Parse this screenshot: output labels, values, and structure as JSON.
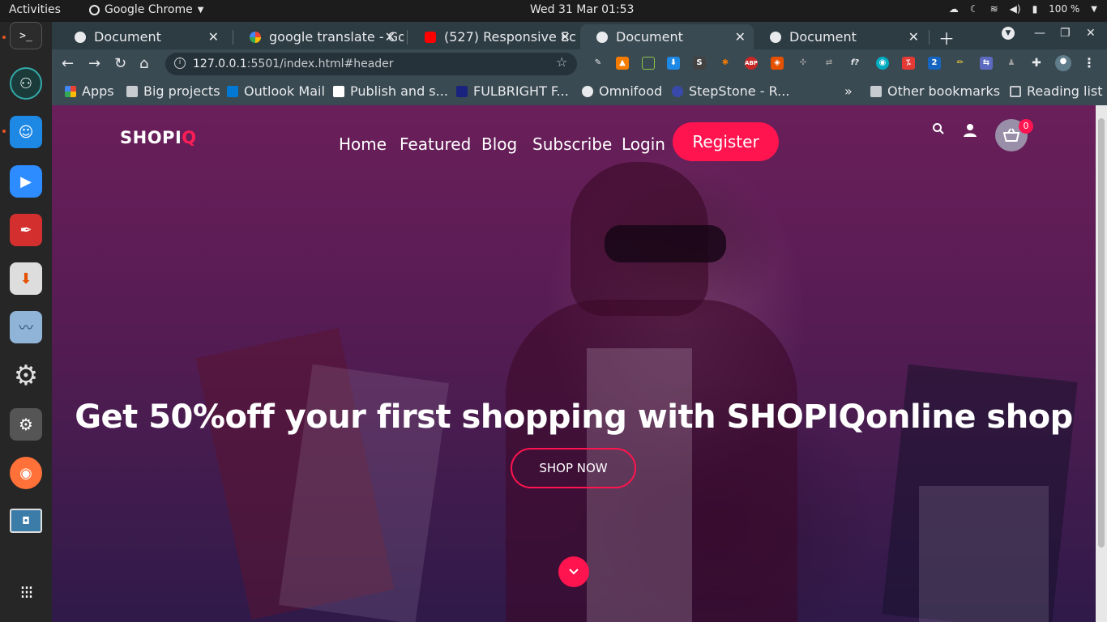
{
  "system": {
    "activities": "Activities",
    "app_name": "Google Chrome",
    "clock": "Wed 31 Mar  01:53",
    "battery": "100 %"
  },
  "tabs": [
    {
      "title": "Document",
      "active": false,
      "favicon_color": "#e8eaed"
    },
    {
      "title": "google translate - Go",
      "active": false,
      "favicon_color": "#4285f4"
    },
    {
      "title": "(527) Responsive Ec",
      "active": false,
      "favicon_color": "#ff0000"
    },
    {
      "title": "Document",
      "active": true,
      "favicon_color": "#e8eaed"
    },
    {
      "title": "Document",
      "active": false,
      "favicon_color": "#e8eaed"
    }
  ],
  "address_bar": {
    "host": "127.0.0.1",
    "path": ":5501/index.html#header"
  },
  "bookmarks": [
    {
      "label": "Apps",
      "icon": "apps-grid-icon"
    },
    {
      "label": "Big projects",
      "icon": "folder-icon"
    },
    {
      "label": "Outlook Mail",
      "icon": "outlook-icon"
    },
    {
      "label": "Publish and s...",
      "icon": "medium-icon"
    },
    {
      "label": "FULBRIGHT F...",
      "icon": "fulbright-icon"
    },
    {
      "label": "Omnifood",
      "icon": "globe-icon"
    },
    {
      "label": "StepStone - R...",
      "icon": "stepstone-icon"
    },
    {
      "label": "Other bookmarks",
      "icon": "folder-icon"
    },
    {
      "label": "Reading list",
      "icon": "reading-list-icon"
    }
  ],
  "page": {
    "logo_main": "SHOPI",
    "logo_accent": "Q",
    "nav": [
      "Home",
      "Featured",
      "Blog",
      "Subscribe",
      "Login"
    ],
    "register": "Register",
    "cart_count": "0",
    "hero_title": "Get 50%off your first shopping with SHOPIQonline shop",
    "shop_now": "SHOP NOW",
    "accent_color": "#ff1450"
  }
}
